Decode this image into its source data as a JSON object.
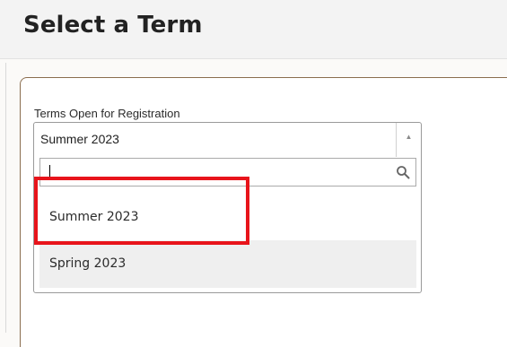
{
  "header": {
    "title": "Select a Term"
  },
  "term_select": {
    "label": "Terms Open for Registration",
    "selected_value": "Summer 2023",
    "search": {
      "value": "",
      "placeholder": ""
    },
    "options": [
      {
        "label": "Summer 2023",
        "highlighted": false
      },
      {
        "label": "Spring 2023",
        "highlighted": true
      }
    ],
    "arrow_glyph": "▲"
  },
  "icons": {
    "arrow": "chevron-up-icon",
    "search": "search-icon"
  },
  "colors": {
    "accent_border": "#8a6d4e",
    "annotation_red": "#e8141b",
    "option_hover": "#efefef"
  }
}
